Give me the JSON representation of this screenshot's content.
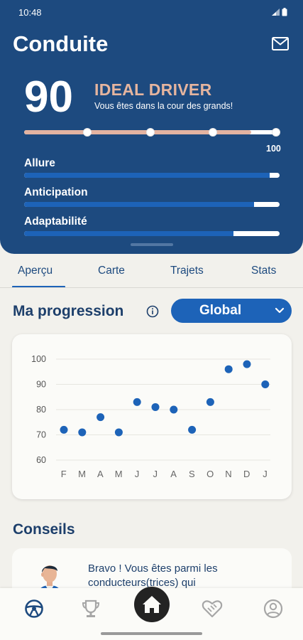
{
  "status_bar": {
    "time": "10:48"
  },
  "header": {
    "title": "Conduite",
    "score": "90",
    "level": "IDEAL DRIVER",
    "level_subtitle": "Vous êtes dans la cour des grands!",
    "score_max_label": "100",
    "score_progress_fraction": 0.9,
    "metrics": [
      {
        "label": "Allure",
        "value_fraction": 0.96
      },
      {
        "label": "Anticipation",
        "value_fraction": 0.9
      },
      {
        "label": "Adaptabilité",
        "value_fraction": 0.82
      }
    ]
  },
  "tabs": [
    {
      "label": "Aperçu",
      "selected": true
    },
    {
      "label": "Carte",
      "selected": false
    },
    {
      "label": "Trajets",
      "selected": false
    },
    {
      "label": "Stats",
      "selected": false
    }
  ],
  "progression": {
    "title": "Ma progression",
    "filter": {
      "selected": "Global"
    }
  },
  "chart_data": {
    "type": "scatter",
    "categories": [
      "F",
      "M",
      "A",
      "M",
      "J",
      "J",
      "A",
      "S",
      "O",
      "N",
      "D",
      "J"
    ],
    "values": [
      72,
      71,
      77,
      71,
      83,
      81,
      80,
      72,
      83,
      96,
      98,
      90
    ],
    "ylim": [
      60,
      100
    ],
    "yticks": [
      60,
      70,
      80,
      90,
      100
    ],
    "grid": true,
    "color": "#1d63b8"
  },
  "conseils": {
    "title": "Conseils",
    "advice_text": "Bravo ! Vous êtes parmi les conducteurs(trices) qui"
  },
  "bottom_nav": {
    "items": [
      {
        "icon": "steering-wheel-icon",
        "active": true
      },
      {
        "icon": "trophy-icon",
        "active": false
      },
      {
        "icon": "home-icon",
        "active": false
      },
      {
        "icon": "heart-hands-icon",
        "active": false
      },
      {
        "icon": "profile-icon",
        "active": false
      }
    ]
  },
  "colors": {
    "header_bg": "#1d4a7f",
    "accent": "#1d63b8",
    "level_color": "#e5b59f"
  }
}
